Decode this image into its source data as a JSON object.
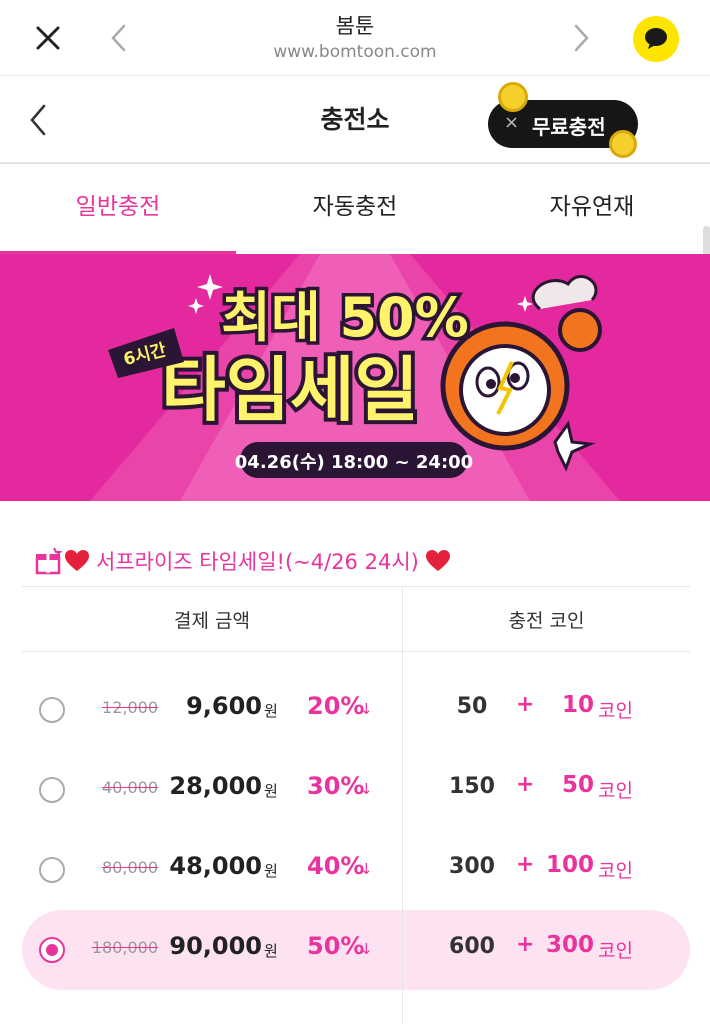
{
  "browser": {
    "title": "봄툰",
    "url": "www.bomtoon.com",
    "icons": [
      "close-icon",
      "back-icon",
      "forward-icon",
      "kakao-talk-icon"
    ]
  },
  "header": {
    "title": "충전소",
    "free_charge_label": "무료충전",
    "free_close": "×",
    "coin_badge": "C"
  },
  "tabs": [
    {
      "label": "일반충전",
      "active": true
    },
    {
      "label": "자동충전",
      "active": false
    },
    {
      "label": "자유연재",
      "active": false
    }
  ],
  "banner": {
    "headline": "최대 50%",
    "title": "타임세일",
    "tag": "6시간",
    "period": "04.26(수) 18:00 ~ 24:00",
    "colors": {
      "background": "#e3299d",
      "text_fill": "#fff36b",
      "text_outline": "#2b1535",
      "clock": "#f2741f"
    }
  },
  "promo": {
    "title": "서프라이즈 타임세일!(~4/26 24시)"
  },
  "table": {
    "headers": {
      "payment": "결제 금액",
      "coins": "충전 코인"
    },
    "currency": "원",
    "coin_unit": "코인",
    "plus": "+",
    "arrow": "↓",
    "rows": [
      {
        "original": "12,000",
        "price": "9,600",
        "discount": "20%",
        "base": "50",
        "bonus": "10",
        "selected": false
      },
      {
        "original": "40,000",
        "price": "28,000",
        "discount": "30%",
        "base": "150",
        "bonus": "50",
        "selected": false
      },
      {
        "original": "80,000",
        "price": "48,000",
        "discount": "40%",
        "base": "300",
        "bonus": "100",
        "selected": false
      },
      {
        "original": "180,000",
        "price": "90,000",
        "discount": "50%",
        "base": "600",
        "bonus": "300",
        "selected": true
      }
    ]
  },
  "colors": {
    "accent": "#e9349e",
    "selected_row": "#fde3f1",
    "kakao": "#fee500"
  }
}
